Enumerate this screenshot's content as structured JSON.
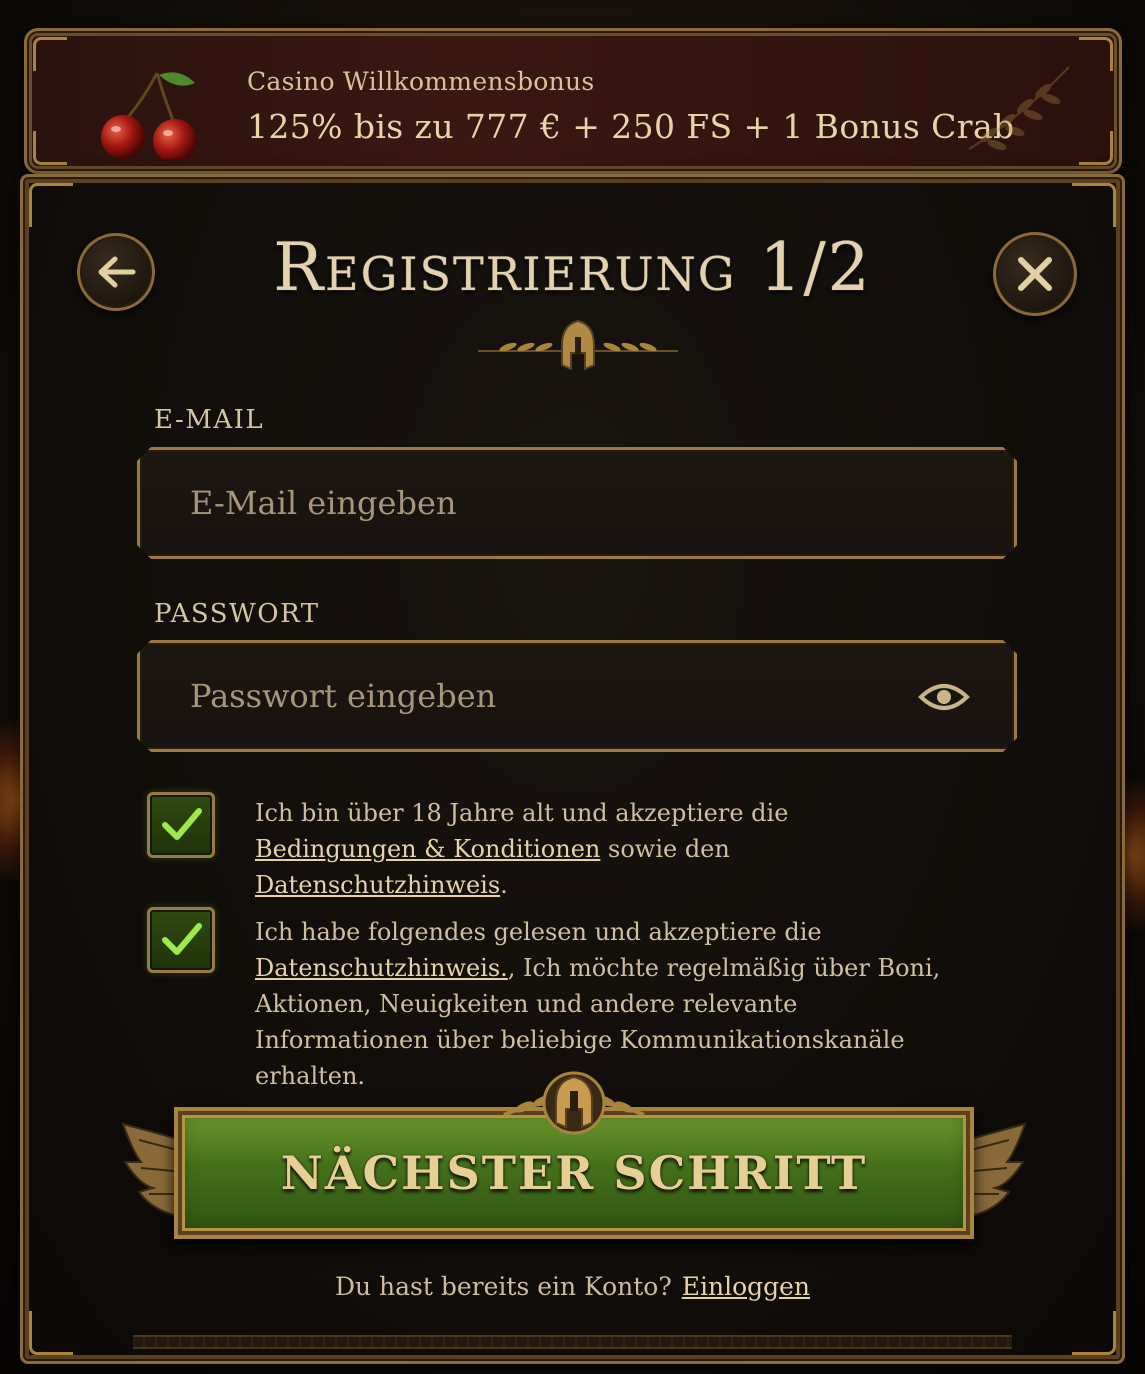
{
  "banner": {
    "title": "Casino Willkommensbonus",
    "offer": "125% bis zu 777 € + 250 FS + 1 Bonus Crab"
  },
  "header": {
    "title": "Registrierung 1/2",
    "back_icon": "arrow-left-icon",
    "close_icon": "close-icon"
  },
  "form": {
    "email": {
      "label": "E-MAIL",
      "placeholder": "E-Mail eingeben",
      "value": ""
    },
    "password": {
      "label": "PASSWORT",
      "placeholder": "Passwort eingeben",
      "value": "",
      "icon": "eye-icon"
    }
  },
  "consents": [
    {
      "checked": true,
      "text_1": "Ich bin über 18 Jahre alt und akzeptiere die ",
      "link_1": "Bedingungen & Konditionen",
      "text_2": " sowie den ",
      "link_2": "Datenschutzhinweis",
      "text_3": "."
    },
    {
      "checked": true,
      "text_1": "Ich habe folgendes gelesen und akzeptiere die ",
      "link_1": "Datenschutzhinweis.",
      "text_2": ", Ich möchte regelmäßig über Boni, Aktionen, Neuigkeiten und andere relevante Informationen über beliebige Kommunikationskanäle erhalten."
    }
  ],
  "next_button": {
    "label": "NÄCHSTER SCHRITT"
  },
  "footer": {
    "question": "Du hast bereits ein Konto?",
    "login_link": "Einloggen"
  },
  "colors": {
    "gold": "#a8843f",
    "button_green": "#44701a",
    "banner_red": "#3a1812"
  }
}
